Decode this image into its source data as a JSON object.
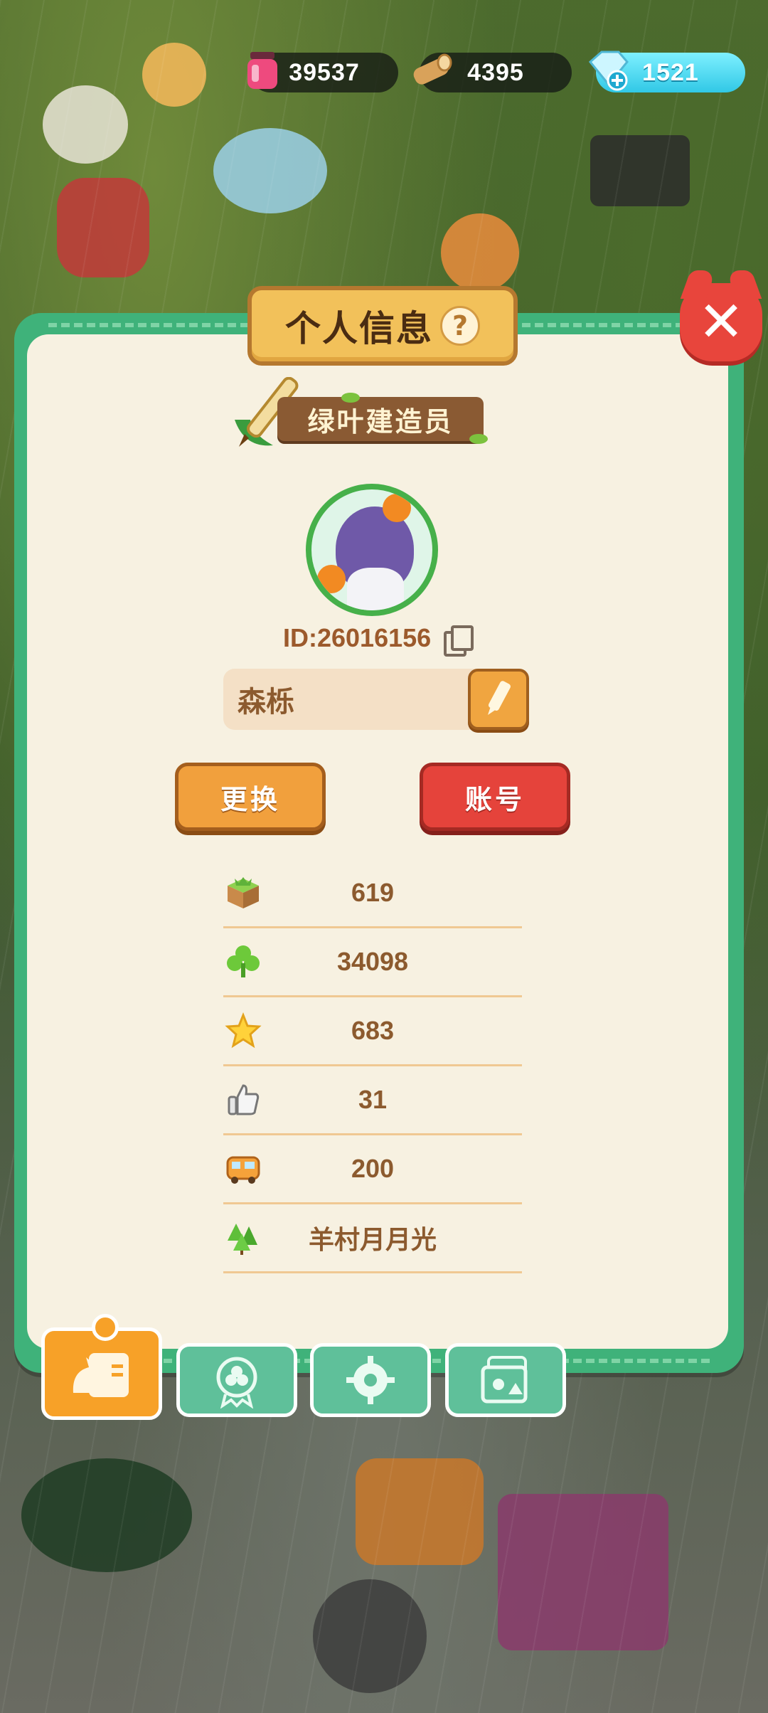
{
  "resources": {
    "ink": {
      "icon": "ink-bottle-icon",
      "value": "39537",
      "color": "#e83a6e"
    },
    "wood": {
      "icon": "wood-log-icon",
      "value": "4395"
    },
    "gems": {
      "icon": "diamond-plus-icon",
      "value": "1521",
      "color": "#31c8e6"
    }
  },
  "dialog": {
    "title": "个人信息",
    "help_icon": "?",
    "close_icon": "✕",
    "builder_title": "绿叶建造员",
    "user_id": "ID:26016156",
    "nickname": "森栎",
    "change_button": "更换",
    "account_button": "账号"
  },
  "stats": [
    {
      "icon": "grass-block-icon",
      "value": "619"
    },
    {
      "icon": "clover-icon",
      "value": "34098"
    },
    {
      "icon": "star-icon",
      "value": "683"
    },
    {
      "icon": "thumbs-up-icon",
      "value": "31"
    },
    {
      "icon": "bus-icon",
      "value": "200"
    },
    {
      "icon": "trees-icon",
      "value": "羊村月月光"
    }
  ],
  "tabs": [
    {
      "icon": "profile-card-icon",
      "active": true
    },
    {
      "icon": "clover-badge-icon",
      "active": false
    },
    {
      "icon": "gear-icon",
      "active": false
    },
    {
      "icon": "photo-album-icon",
      "active": false
    }
  ],
  "colors": {
    "panel_green": "#3fb27a",
    "panel_cream": "#f7f1e1",
    "accent_orange": "#f1a03d",
    "accent_red": "#e5433b",
    "text_brown": "#8c5a2e"
  }
}
